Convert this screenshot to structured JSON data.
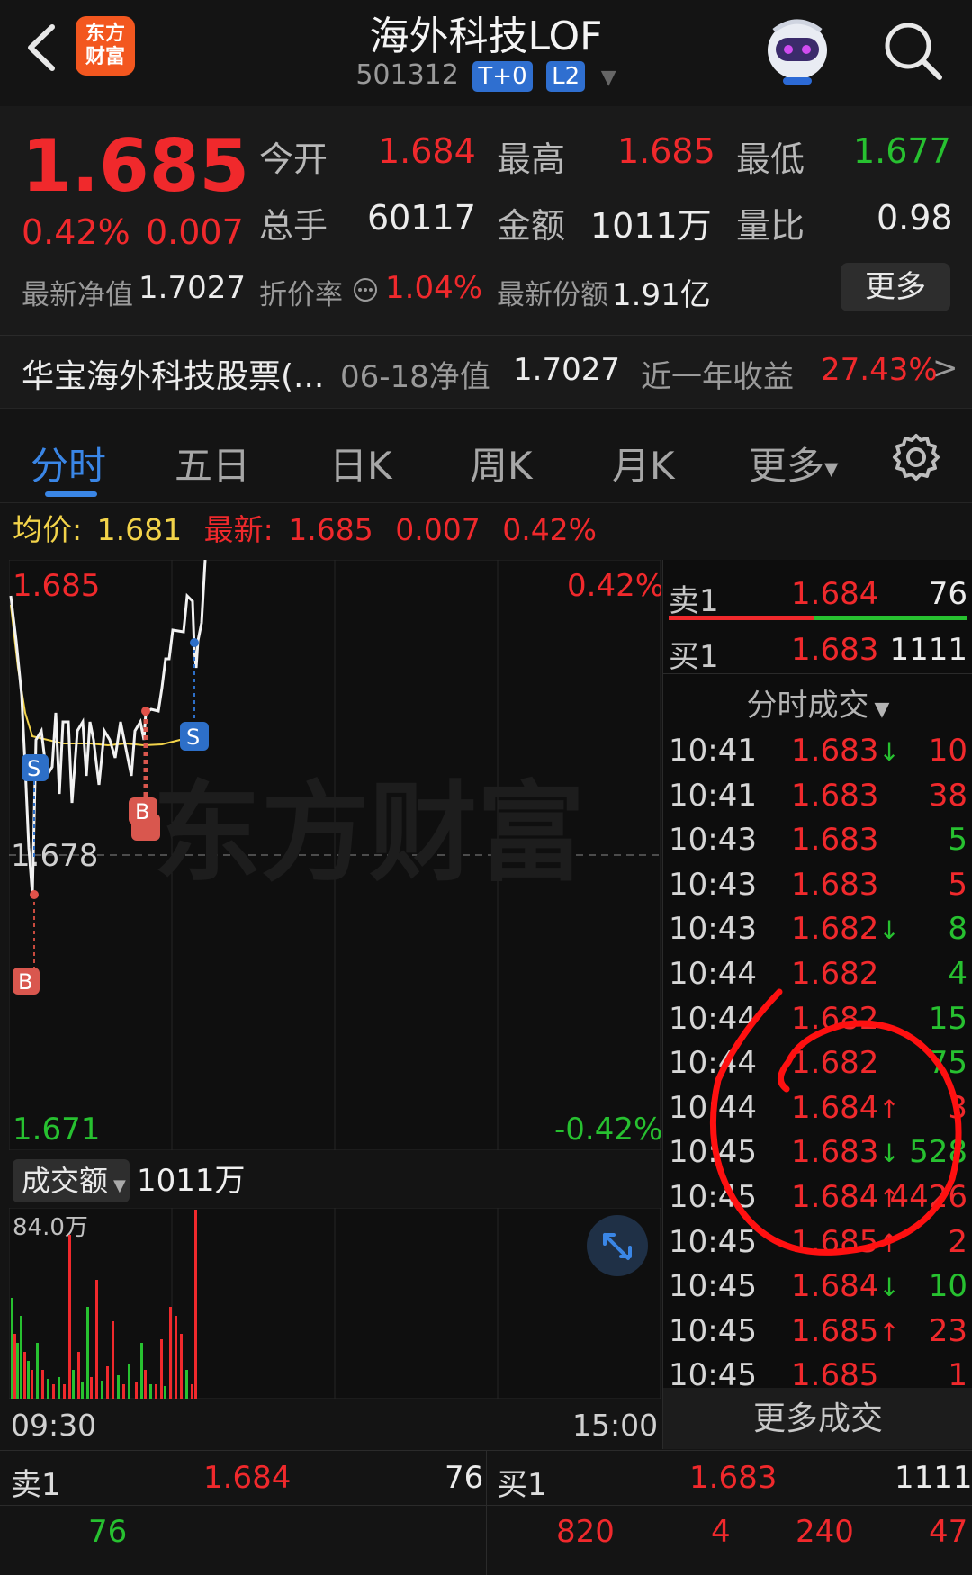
{
  "header": {
    "title": "海外科技LOF",
    "code": "501312",
    "tags": [
      "T+0",
      "L2"
    ],
    "logo_text_1": "东方",
    "logo_text_2": "财富"
  },
  "quote": {
    "price": "1.685",
    "change_pct": "0.42%",
    "change_abs": "0.007",
    "open_label": "今开",
    "open_value": "1.684",
    "high_label": "最高",
    "high_value": "1.685",
    "low_label": "最低",
    "low_value": "1.677",
    "volume_label": "总手",
    "volume_value": "60117",
    "amount_label": "金额",
    "amount_value": "1011万",
    "ratio_label": "量比",
    "ratio_value": "0.98",
    "nav_label": "最新净值",
    "nav_value": "1.7027",
    "discount_label": "折价率",
    "discount_value": "1.04%",
    "shares_label": "最新份额",
    "shares_value": "1.91亿",
    "more_button": "更多"
  },
  "fund": {
    "name": "华宝海外科技股票(...",
    "nav_date_label": "06-18净值",
    "nav_value": "1.7027",
    "return_label": "近一年收益",
    "return_value": "27.43%",
    "arrow": ">"
  },
  "tabs": [
    "分时",
    "五日",
    "日K",
    "周K",
    "月K",
    "更多"
  ],
  "chart_header": {
    "avg_label": "均价:",
    "avg_value": "1.681",
    "latest_label": "最新:",
    "latest_value": "1.685",
    "latest_change": "0.007",
    "latest_pct": "0.42%"
  },
  "chart_labels": {
    "top_price": "1.685",
    "top_pct": "0.42%",
    "mid_price": "1.678",
    "bottom_price": "1.671",
    "bottom_pct": "-0.42%",
    "watermark": "东方财富"
  },
  "volume": {
    "button": "成交额",
    "value": "1011万",
    "max_label": "84.0万",
    "time_start": "09:30",
    "time_end": "15:00"
  },
  "orderbook_right": {
    "sell_label": "卖1",
    "sell_price": "1.684",
    "sell_qty": "76",
    "buy_label": "买1",
    "buy_price": "1.683",
    "buy_qty": "1111",
    "trades_title": "分时成交",
    "more_trades": "更多成交"
  },
  "trades": [
    {
      "time": "10:41",
      "price": "1.683",
      "dir": "↓",
      "qty": "10",
      "qcolor": "red"
    },
    {
      "time": "10:41",
      "price": "1.683",
      "dir": "",
      "qty": "38",
      "qcolor": "red"
    },
    {
      "time": "10:43",
      "price": "1.683",
      "dir": "",
      "qty": "5",
      "qcolor": "green"
    },
    {
      "time": "10:43",
      "price": "1.683",
      "dir": "",
      "qty": "5",
      "qcolor": "red"
    },
    {
      "time": "10:43",
      "price": "1.682",
      "dir": "↓",
      "qty": "8",
      "qcolor": "green"
    },
    {
      "time": "10:44",
      "price": "1.682",
      "dir": "",
      "qty": "4",
      "qcolor": "green"
    },
    {
      "time": "10:44",
      "price": "1.682",
      "dir": "",
      "qty": "15",
      "qcolor": "green"
    },
    {
      "time": "10:44",
      "price": "1.682",
      "dir": "",
      "qty": "75",
      "qcolor": "green"
    },
    {
      "time": "10:44",
      "price": "1.684",
      "dir": "↑",
      "qty": "3",
      "qcolor": "red"
    },
    {
      "time": "10:45",
      "price": "1.683",
      "dir": "↓",
      "qty": "528",
      "qcolor": "green"
    },
    {
      "time": "10:45",
      "price": "1.684",
      "dir": "↑",
      "qty": "4426",
      "qcolor": "red"
    },
    {
      "time": "10:45",
      "price": "1.685",
      "dir": "↑",
      "qty": "2",
      "qcolor": "red"
    },
    {
      "time": "10:45",
      "price": "1.684",
      "dir": "↓",
      "qty": "10",
      "qcolor": "green"
    },
    {
      "time": "10:45",
      "price": "1.685",
      "dir": "↑",
      "qty": "23",
      "qcolor": "red"
    },
    {
      "time": "10:45",
      "price": "1.685",
      "dir": "",
      "qty": "1",
      "qcolor": "red"
    }
  ],
  "bottom_book": {
    "sell_label": "卖1",
    "sell_price": "1.684",
    "sell_qty": "76",
    "buy_label": "买1",
    "buy_price": "1.683",
    "buy_qty": "1111",
    "row2_left": "76",
    "row2_right": [
      "820",
      "4",
      "240",
      "47"
    ]
  },
  "colors": {
    "up": "#f0292c",
    "down": "#27c130",
    "accent": "#3a86e6",
    "avg_line": "#f2d34a",
    "annotation": "#ff1010"
  }
}
